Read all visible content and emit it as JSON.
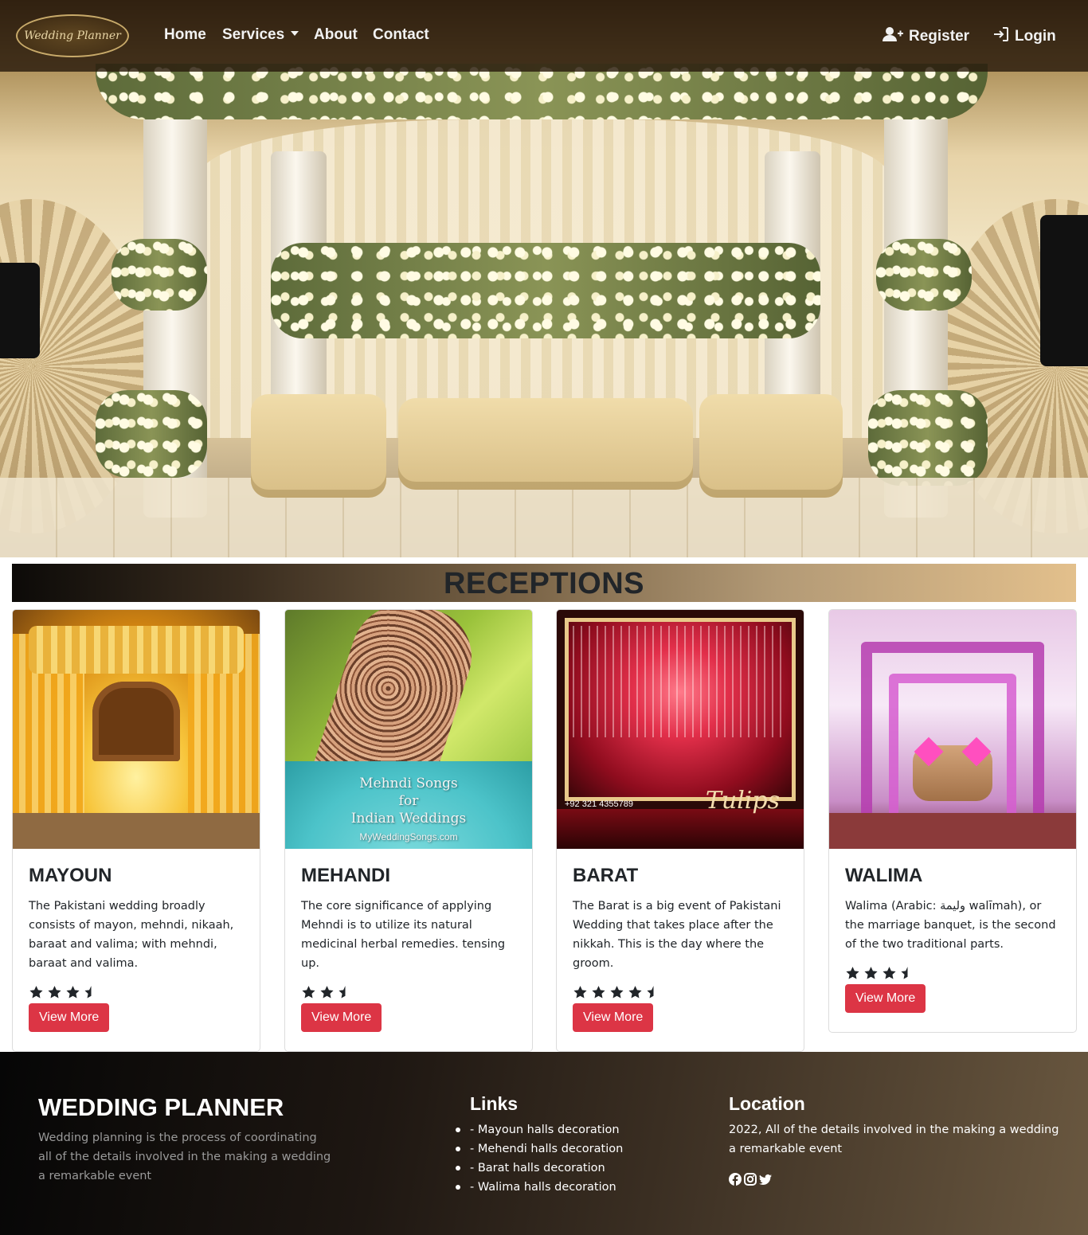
{
  "nav": {
    "logo_text": "Wedding Planner",
    "home": "Home",
    "services": "Services",
    "about": "About",
    "contact": "Contact",
    "register": "Register",
    "login": "Login"
  },
  "banner": {
    "title": "RECEPTIONS"
  },
  "cards": [
    {
      "title": "MAYOUN",
      "text": "The Pakistani wedding broadly consists of mayon, mehndi, nikaah, baraat and valima; with mehndi, baraat and valima.",
      "rating": 3.5,
      "button": "View More"
    },
    {
      "title": "MEHANDI",
      "text": "The core significance of applying Mehndi is to utilize its natural medicinal herbal remedies. tensing up.",
      "rating": 2.5,
      "button": "View More",
      "image_caption": [
        "Mehndi Songs",
        "for",
        "Indian Weddings",
        "MyWeddingSongs.com"
      ]
    },
    {
      "title": "BARAT",
      "text": "The Barat is a big event of Pakistani Wedding that takes place after the nikkah. This is the day where the groom.",
      "rating": 4.5,
      "button": "View More",
      "image_caption": [
        "+92 321 4355789",
        "Tulips"
      ]
    },
    {
      "title": "WALIMA",
      "text": "Walima (Arabic: وليمة walīmah), or the marriage banquet, is the second of the two traditional parts.",
      "rating": 3.5,
      "button": "View More"
    }
  ],
  "footer": {
    "brand": "WEDDING PLANNER",
    "description": "Wedding planning is the process of coordinating all of the details involved in the making a wedding a remarkable event",
    "links_title": "Links",
    "links": [
      "- Mayoun halls decoration",
      "- Mehendi halls decoration",
      "- Barat halls decoration",
      "- Walima halls decoration"
    ],
    "location_title": "Location",
    "location_text": "2022, All of the details involved in the making a wedding a remarkable event",
    "social": [
      "facebook-icon",
      "instagram-icon",
      "twitter-icon"
    ]
  },
  "colors": {
    "accent_button": "#dc3545",
    "nav_bg": "#281a0c",
    "text_dark": "#212529"
  }
}
